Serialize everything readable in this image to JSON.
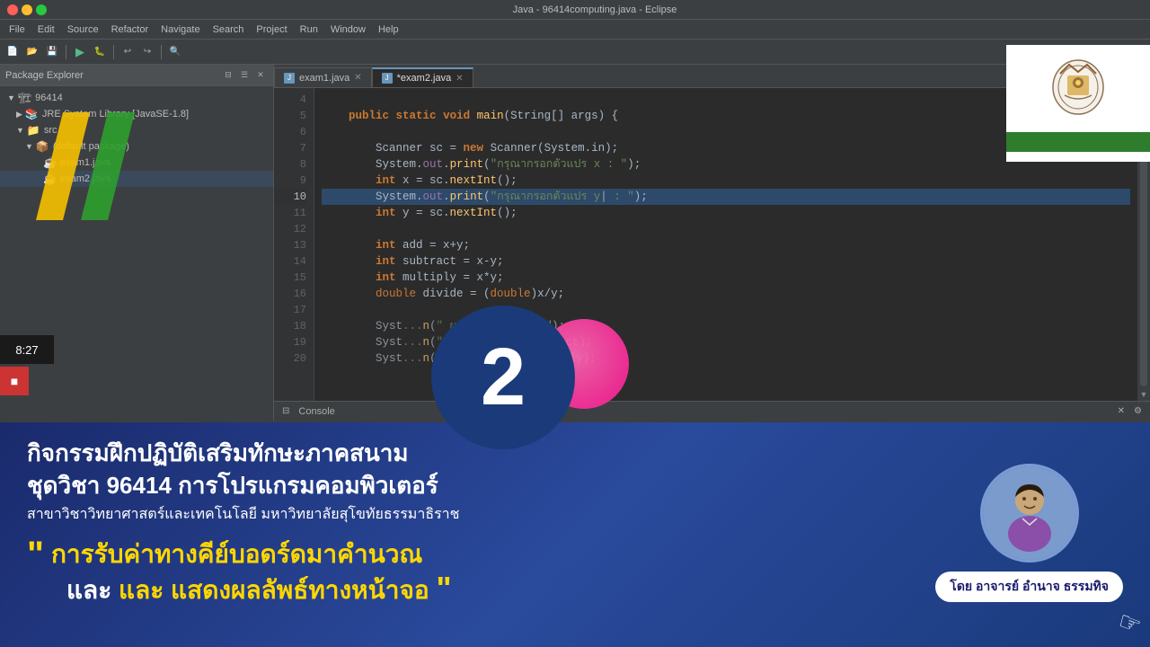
{
  "title_bar": {
    "text": "Java - 96414computing.java - Eclipse"
  },
  "menu": {
    "items": [
      "File",
      "Edit",
      "Source",
      "Refactor",
      "Navigate",
      "Search",
      "Project",
      "Run",
      "Window",
      "Help"
    ]
  },
  "tabs": [
    {
      "label": "exam1.java",
      "active": false
    },
    {
      "label": "*exam2.java",
      "active": true
    }
  ],
  "package_explorer": {
    "header": "Package Explorer",
    "items": [
      {
        "label": "96414",
        "indent": 0,
        "icon": "📁",
        "arrow": "▼"
      },
      {
        "label": "JRE System Library [JavaSE-1.8]",
        "indent": 1,
        "icon": "📚",
        "arrow": "▶"
      },
      {
        "label": "src",
        "indent": 1,
        "icon": "📁",
        "arrow": "▼"
      },
      {
        "label": "(default package)",
        "indent": 2,
        "icon": "📦",
        "arrow": "▼"
      },
      {
        "label": "exam1.java",
        "indent": 3,
        "icon": "☕",
        "arrow": ""
      },
      {
        "label": "exam2.java",
        "indent": 3,
        "icon": "☕",
        "arrow": ""
      }
    ]
  },
  "code": {
    "lines": [
      {
        "num": 4,
        "content": "",
        "highlighted": false
      },
      {
        "num": 5,
        "content": "    public static void main(String[] args) {",
        "highlighted": false
      },
      {
        "num": 6,
        "content": "",
        "highlighted": false
      },
      {
        "num": 7,
        "content": "        Scanner sc = new Scanner(System.in);",
        "highlighted": false
      },
      {
        "num": 8,
        "content": "        System.out.print(\"กรุณากรอกตัวแปร x : \");",
        "highlighted": false
      },
      {
        "num": 9,
        "content": "        int x = sc.nextInt();",
        "highlighted": false
      },
      {
        "num": 10,
        "content": "        System.out.print(\"กรุณากรอกตัวแปร y : \");",
        "highlighted": true
      },
      {
        "num": 11,
        "content": "        int y = sc.nextInt();",
        "highlighted": false
      },
      {
        "num": 12,
        "content": "",
        "highlighted": false
      },
      {
        "num": 13,
        "content": "        int add = x+y;",
        "highlighted": false
      },
      {
        "num": 14,
        "content": "        int subtract = x-y;",
        "highlighted": false
      },
      {
        "num": 15,
        "content": "        int multiply = x*y;",
        "highlighted": false
      },
      {
        "num": 16,
        "content": "        double divide = (double)x/y;",
        "highlighted": false
      },
      {
        "num": 17,
        "content": "",
        "highlighted": false
      },
      {
        "num": 18,
        "content": "        System.out.println(\"ผลบวกคือ \" + add);",
        "highlighted": false
      },
      {
        "num": 19,
        "content": "        System.out.println(\"ผลลบคือ \" + subtract);",
        "highlighted": false
      },
      {
        "num": 20,
        "content": "        System.out.println(\"ผลคูณคือ \" + multiply);",
        "highlighted": false
      }
    ]
  },
  "timestamp": "8:27",
  "number_overlay": "2",
  "overlay": {
    "line1": "กิจกรรมฝึกปฏิบัติเสริมทักษะภาคสนาม",
    "line2a": "ชุดวิชา 96414 การโปรแกรมคอมพิวเตอร์",
    "line2b": "สาขาวิชาวิทยาศาสตร์และเทคโนโลยี มหาวิทยาลัยสุโขทัยธรรมาธิราช",
    "quote1": "การรับค่าทางคีย์บอดร์ดมาคำนวณ",
    "quote2": "และ แสดงผลลัพธ์ทางหน้าจอ"
  },
  "instructor": {
    "label": "โดย อาจารย์ อำนาจ ธรรมทิจ"
  }
}
